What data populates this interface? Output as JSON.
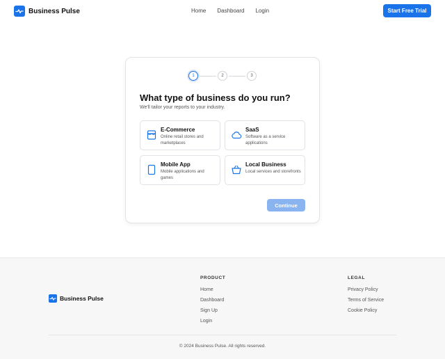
{
  "header": {
    "brand": "Business Pulse",
    "nav": [
      "Home",
      "Dashboard",
      "Login"
    ],
    "cta": "Start Free Trial"
  },
  "wizard": {
    "steps": [
      "1",
      "2",
      "3"
    ],
    "current_step": 1,
    "title": "What type of business do you run?",
    "subtitle": "We'll tailor your reports to your industry.",
    "options": [
      {
        "title": "E-Commerce",
        "desc": "Online retail stores and marketplaces",
        "icon": "store-icon"
      },
      {
        "title": "SaaS",
        "desc": "Software as a service applications",
        "icon": "cloud-icon"
      },
      {
        "title": "Mobile App",
        "desc": "Mobile applications and games",
        "icon": "smartphone-icon"
      },
      {
        "title": "Local Business",
        "desc": "Local services and storefronts",
        "icon": "basket-icon"
      }
    ],
    "continue_label": "Continue"
  },
  "footer": {
    "brand": "Business Pulse",
    "product_heading": "PRODUCT",
    "product_links": [
      "Home",
      "Dashboard",
      "Sign Up",
      "Login"
    ],
    "legal_heading": "LEGAL",
    "legal_links": [
      "Privacy Policy",
      "Terms of Service",
      "Cookie Policy"
    ],
    "copyright": "© 2024 Business Pulse. All rights reserved."
  },
  "colors": {
    "primary": "#1a73e8",
    "primary_disabled": "#8ab4ef",
    "footer_bg": "#f7f7f8"
  }
}
